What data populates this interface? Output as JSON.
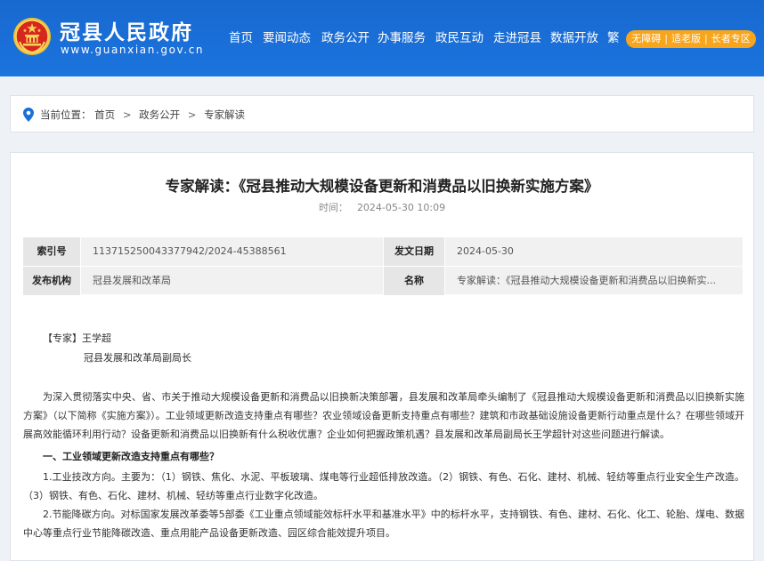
{
  "header": {
    "site_title": "冠县人民政府",
    "site_url": "www.guanxian.gov.cn",
    "nav": [
      "首页",
      "要闻动态",
      "政务公开",
      "办事服务",
      "政民互动",
      "走进冠县",
      "数据开放",
      "繁"
    ],
    "accessibility": [
      "无障碍",
      "适老版",
      "长者专区"
    ],
    "brand_color": "#1a6fd8",
    "accent_color": "#f7a51c"
  },
  "breadcrumb": {
    "label": "当前位置：",
    "items": [
      "首页",
      "政务公开",
      "专家解读"
    ]
  },
  "article": {
    "title": "专家解读：《冠县推动大规模设备更新和消费品以旧换新实施方案》",
    "time_label": "时间：",
    "time_value": "2024-05-30 10:09",
    "meta": {
      "index_label": "索引号",
      "index_value": "113715250043377942/2024-45388561",
      "date_label": "发文日期",
      "date_value": "2024-05-30",
      "org_label": "发布机构",
      "org_value": "冠县发展和改革局",
      "name_label": "名称",
      "name_value": "专家解读：《冠县推动大规模设备更新和消费品以旧换新实..."
    },
    "expert_line": "【专家】王学超",
    "expert_title": "冠县发展和改革局副局长",
    "intro": "为深入贯彻落实中央、省、市关于推动大规模设备更新和消费品以旧换新决策部署，县发展和改革局牵头编制了《冠县推动大规模设备更新和消费品以旧换新实施方案》（以下简称《实施方案》）。工业领域更新改造支持重点有哪些？农业领域设备更新支持重点有哪些？建筑和市政基础设施设备更新行动重点是什么？在哪些领域开展高效能循环利用行动？设备更新和消费品以旧换新有什么税收优惠？企业如何把握政策机遇？县发展和改革局副局长王学超针对这些问题进行解读。",
    "section_heading": "一、工业领域更新改造支持重点有哪些？",
    "point1": "1.工业技改方向。主要为：（1）钢铁、焦化、水泥、平板玻璃、煤电等行业超低排放改造。（2）钢铁、有色、石化、建材、机械、轻纺等重点行业安全生产改造。（3）钢铁、有色、石化、建材、机械、轻纺等重点行业数字化改造。",
    "point2": "2.节能降碳方向。对标国家发展改革委等5部委《工业重点领域能效标杆水平和基准水平》中的标杆水平，支持钢铁、有色、建材、石化、化工、轮胎、煤电、数据中心等重点行业节能降碳改造、重点用能产品设备更新改造、园区综合能效提升项目。"
  }
}
